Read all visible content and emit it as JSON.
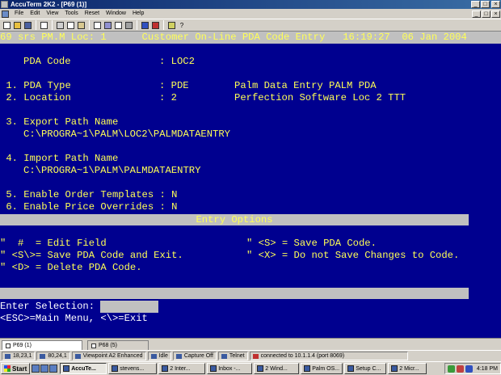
{
  "window": {
    "title": "AccuTerm 2K2 - [P69 (1)]",
    "min_glyph": "_",
    "max_glyph": "□",
    "close_glyph": "×"
  },
  "menu": {
    "items": [
      "File",
      "Edit",
      "View",
      "Tools",
      "Reset",
      "Window",
      "Help"
    ],
    "mdi_min": "_",
    "mdi_max": "□",
    "mdi_close": "×"
  },
  "toolbar": {
    "help_glyph": "?"
  },
  "terminal": {
    "status_line": "69 srs PM.M Loc: 1      Customer On-Line PDA Code Entry   16:19:27  06 Jan 2004",
    "pda_code_label": "PDA Code",
    "pda_code_value": ": LOC2",
    "field1_label": " 1. PDA Type",
    "field1_value": ": PDE",
    "field1_desc": "Palm Data Entry PALM PDA",
    "field2_label": " 2. Location",
    "field2_value": ": 2",
    "field2_desc": "Perfection Software Loc 2 TTT",
    "field3_label": " 3. Export Path Name",
    "field3_path": "C:\\PROGRA~1\\PALM\\LOC2\\PALMDATAENTRY",
    "field4_label": " 4. Import Path Name",
    "field4_path": "C:\\PROGRA~1\\PALM\\PALMDATAENTRY",
    "field5": " 5. Enable Order Templates : N",
    "field6": " 6. Enable Price Overrides : N",
    "options_title": "Entry Options",
    "opt_left_1": "\"  #  = Edit Field",
    "opt_left_2": "\" <S\\>= Save PDA Code and Exit.",
    "opt_left_3": "\" <D> = Delete PDA Code.",
    "opt_right_1": "\" <S> = Save PDA Code.",
    "opt_right_2": "\" <X> = Do not Save Changes to Code.",
    "prompt": "Enter Selection:",
    "help_line": "<ESC>=Main Menu, <\\>=Exit"
  },
  "tabs": [
    {
      "label": "P69 (1)",
      "active": true
    },
    {
      "label": "P68 (5)",
      "active": false
    }
  ],
  "statusbar": {
    "pos1": "18,23,1",
    "pos2": "80,24,1",
    "emulation": "Viewpoint A2 Enhanced",
    "state": "Idle",
    "capture": "Capture Off",
    "protocol": "Telnet",
    "connection": "connected to 10.1.1.4 (port 8069)"
  },
  "taskbar": {
    "start_label": "Start",
    "buttons": [
      {
        "label": "AccuTe...",
        "active": true
      },
      {
        "label": "stevens...",
        "active": false
      },
      {
        "label": "2 Inter...",
        "active": false
      },
      {
        "label": "Inbox -...",
        "active": false
      },
      {
        "label": "2 Wind...",
        "active": false
      },
      {
        "label": "Palm OS...",
        "active": false
      },
      {
        "label": "Setup C...",
        "active": false
      },
      {
        "label": "2 Micr...",
        "active": false
      }
    ],
    "clock": "4:18 PM"
  }
}
